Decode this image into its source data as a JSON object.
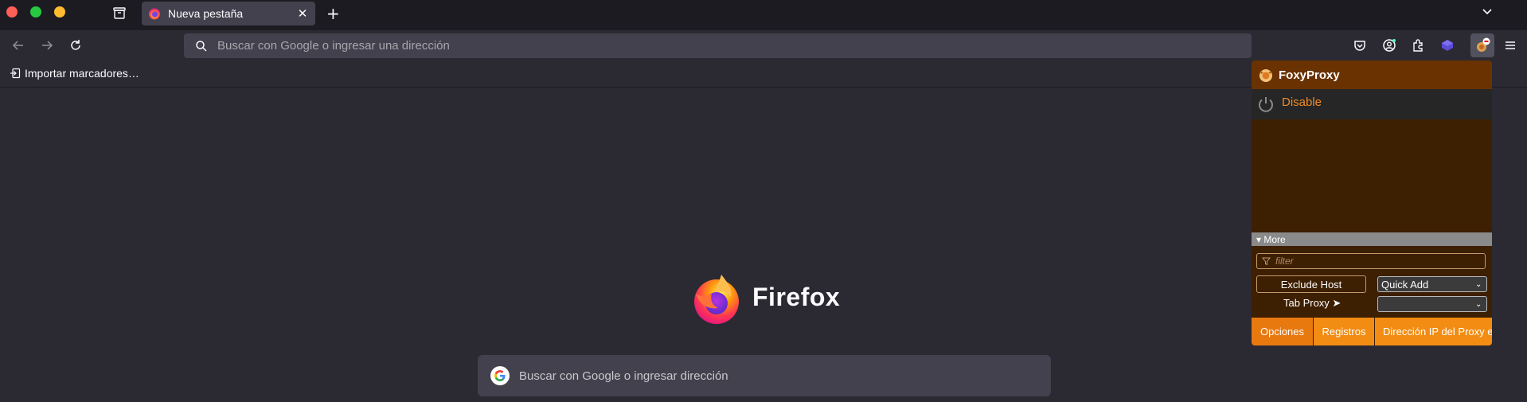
{
  "tabs": [
    {
      "label": "Nueva pestaña"
    }
  ],
  "urlbar": {
    "placeholder": "Buscar con Google o ingresar una dirección"
  },
  "bookmarks": {
    "import_label": "Importar marcadores…"
  },
  "newtab": {
    "brand": "Firefox",
    "search_placeholder": "Buscar con Google o ingresar dirección"
  },
  "foxyproxy": {
    "title": "FoxyProxy",
    "disable_label": "Disable",
    "more_label": "▾ More",
    "filter_placeholder": "filter",
    "exclude_host_label": "Exclude Host",
    "quick_add_label": "Quick Add",
    "tab_proxy_label": "Tab Proxy ➤",
    "tab_proxy_value": "",
    "footer": {
      "opciones": "Opciones",
      "registros": "Registros",
      "ip": "Dirección IP del Proxy e"
    }
  },
  "colors": {
    "accent": "#f28c13",
    "header": "#6a3200",
    "panel": "#3d1f02"
  }
}
